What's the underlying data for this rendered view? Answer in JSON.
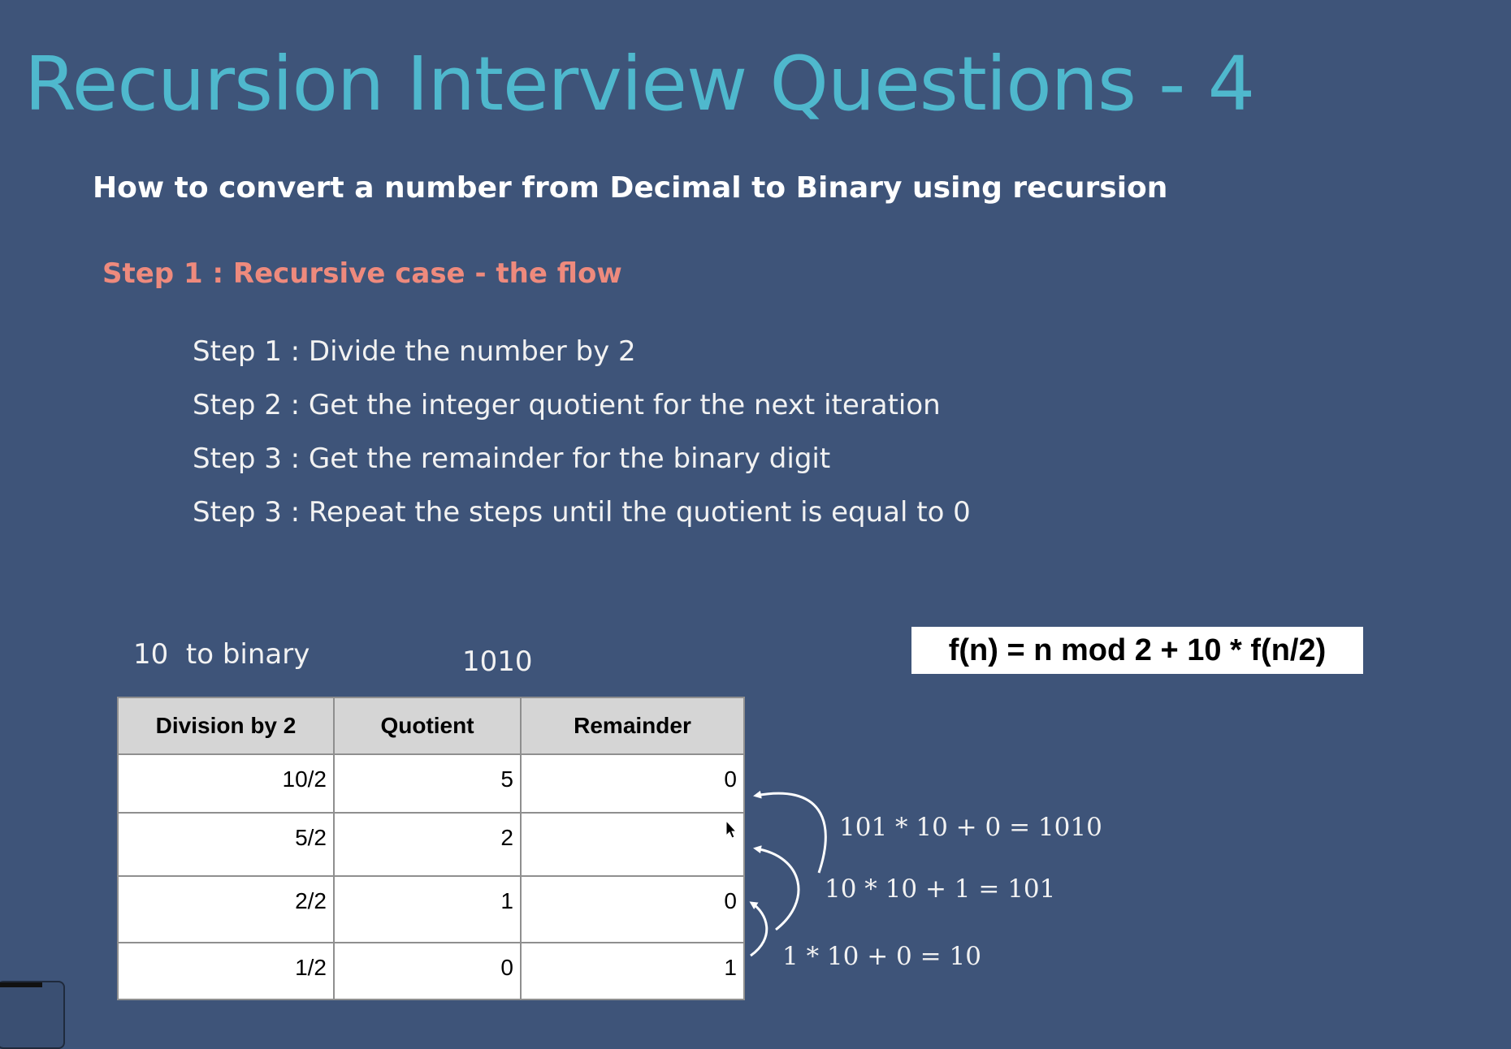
{
  "slide": {
    "title": "Recursion Interview Questions - 4",
    "subtitle": "How to convert a number from Decimal to Binary using recursion",
    "step_heading": "Step 1 : Recursive case - the flow",
    "steps": [
      "Step 1 : Divide the number by 2",
      "Step 2 : Get the integer quotient for the next iteration",
      "Step 3 : Get the remainder for the binary digit",
      "Step 3 : Repeat the steps until the quotient is equal to 0"
    ]
  },
  "example": {
    "label": "10  to binary",
    "result": "1010",
    "formula": "f(n) = n mod 2 + 10 * f(n/2)"
  },
  "table": {
    "headers": [
      "Division by 2",
      "Quotient",
      "Remainder"
    ],
    "rows": [
      [
        "10/2",
        "5",
        "0"
      ],
      [
        "5/2",
        "2",
        ""
      ],
      [
        "2/2",
        "1",
        "0"
      ],
      [
        "1/2",
        "0",
        "1"
      ]
    ]
  },
  "calculations": [
    "101 * 10 + 0 = 1010",
    "10 * 10 + 1 = 101",
    "1 * 10 + 0 = 10"
  ],
  "colors": {
    "background": "#3e5479",
    "title": "#4fb8cd",
    "step_heading": "#ee8a7d",
    "table_header": "#d5d5d5"
  },
  "icons": [
    "arrow-icon",
    "cursor-icon"
  ]
}
